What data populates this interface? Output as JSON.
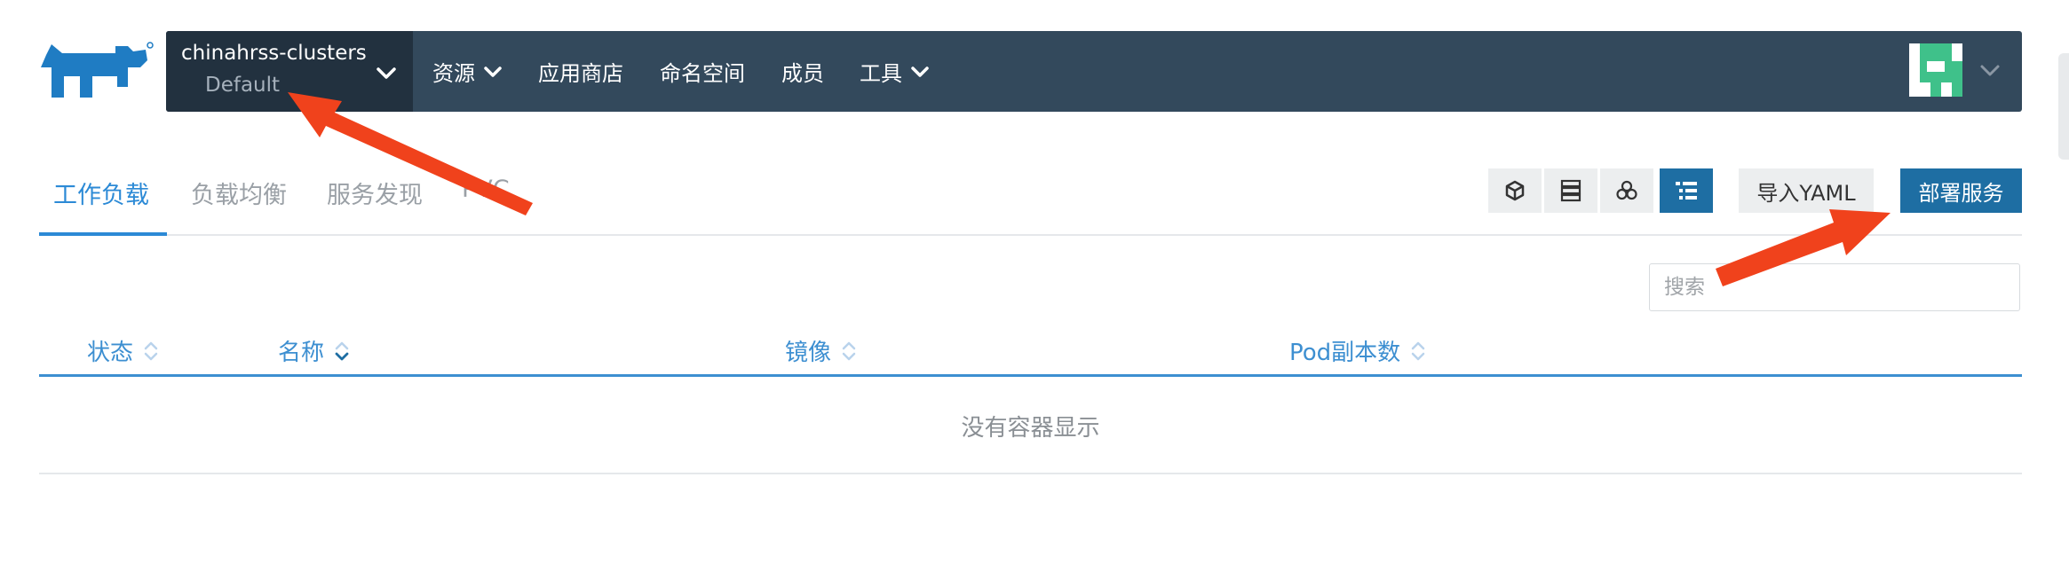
{
  "navbar": {
    "cluster_name": "chinahrss-clusters",
    "project_name": "Default",
    "items": [
      {
        "label": "资源",
        "dropdown": true
      },
      {
        "label": "应用商店",
        "dropdown": false
      },
      {
        "label": "命名空间",
        "dropdown": false
      },
      {
        "label": "成员",
        "dropdown": false
      },
      {
        "label": "工具",
        "dropdown": true
      }
    ],
    "logo": "rancher-logo",
    "avatar": "user-avatar"
  },
  "tabs": [
    {
      "label": "工作负载",
      "active": true
    },
    {
      "label": "负载均衡",
      "active": false
    },
    {
      "label": "服务发现",
      "active": false
    },
    {
      "label": "PVC",
      "active": false
    }
  ],
  "toolbar": {
    "view_icons": [
      "cube-icon",
      "list-rows-icon",
      "cluster-icon",
      "tree-list-icon"
    ],
    "active_view": "tree-list-icon",
    "import_label": "导入YAML",
    "deploy_label": "部署服务"
  },
  "search": {
    "placeholder": "搜索",
    "value": ""
  },
  "table": {
    "columns": [
      "状态",
      "名称",
      "镜像",
      "Pod副本数"
    ],
    "empty_text": "没有容器显示"
  },
  "colors": {
    "navbar": "#33495c",
    "cluster_bg": "#22313f",
    "accent": "#2c8ad6",
    "primary_button": "#1e6ea3",
    "annotation_arrow": "#f0421c"
  }
}
